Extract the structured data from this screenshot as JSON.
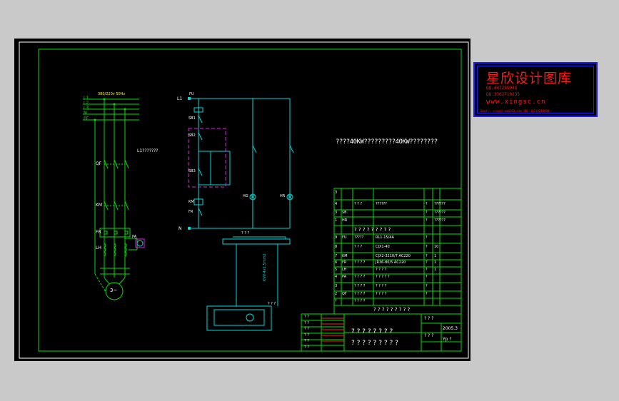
{
  "power_circuit": {
    "supply_label": "380/220v 50Hz",
    "lines": [
      "L1",
      "L2",
      "L3",
      "N",
      "PE"
    ],
    "breaker_note": "L1???????",
    "components": {
      "breaker": "QF",
      "contactor": "KM",
      "relay": "FR",
      "transformer": "LH",
      "ammeter": "PA",
      "motor": "3~"
    }
  },
  "control_circuit": {
    "terminals": {
      "top": "L1",
      "bottom": "N"
    },
    "fuse": "FU",
    "stop_button": "SB1",
    "start_button": "SB2",
    "local_remote": "SB3",
    "relay_contact": "FR",
    "coil": "KM",
    "lamp_green": "HG",
    "lamp_red": "HR",
    "terminal_strip_label": "? ? ?",
    "cable_label": "KVV-4x1.5mm2",
    "station_label": "? ? ?"
  },
  "drawing_title": "????40KW?????????40KW????????",
  "parts_table": {
    "header_cols": [
      "",
      "",
      "",
      "",
      "",
      ""
    ],
    "rows": [
      [
        "3",
        "",
        "",
        "",
        "",
        ""
      ],
      [
        "4",
        "",
        "? ? ?",
        "??????",
        "?",
        "??????"
      ],
      [
        "3",
        "SB",
        "",
        "",
        "?",
        "??????"
      ],
      [
        "1",
        "HR",
        "",
        "",
        "?",
        "??????"
      ],
      [
        "",
        "",
        "? ? ? ? ? ? ? ? ?",
        "",
        "",
        ""
      ],
      [
        "9",
        "FU",
        "?????",
        "RL1-15/4A",
        "?",
        ""
      ],
      [
        "8",
        "",
        "? ? ?",
        "CJX1-40",
        "?",
        "10"
      ],
      [
        "7",
        "KM",
        "",
        "CJX2-3210/7 AC220",
        "?",
        "1"
      ],
      [
        "6",
        "FR",
        "? ? ? ?",
        "JR36-80/5 AC220",
        "?",
        "1"
      ],
      [
        "5",
        "LH",
        "",
        "? ? ? ?",
        "?",
        "1"
      ],
      [
        "4",
        "PA",
        "? ? ? ?",
        "? ? ? ? ?",
        "?",
        ""
      ],
      [
        "3",
        "",
        "? ? ? ?",
        "? ? ? ?",
        "?",
        ""
      ],
      [
        "2",
        "QF",
        "? ? ? ?",
        "? ? ? ?",
        "?",
        ""
      ],
      [
        "?",
        "",
        "? ? ? ?",
        "",
        "",
        ""
      ]
    ],
    "footer": "? ? ? ? ? ? ? ? ?"
  },
  "title_block": {
    "left_rows": [
      "? ?",
      "? ?",
      "? ?",
      "? ?",
      "? ?",
      "? ?"
    ],
    "name1": "? ? ? ? ? ? ? ?",
    "name2": "? ? ? ? ? ? ? ? ?",
    "right_cells": [
      "? ? ?",
      "2005.3",
      "? ? ?",
      "Yp ?"
    ]
  },
  "stamp": {
    "title": "星欣设计图库",
    "qq1": "QQ:447255935",
    "qq2": "QQ:3362719235",
    "url": "www.xingsc.cn",
    "email": "Email: xingsccom@163.com  TEL:15110248800"
  },
  "colors": {
    "green": "#00e000",
    "cyan": "#00d8d8",
    "magenta": "#e020e0",
    "red": "#ff2020",
    "white": "#ffffff",
    "yellow": "#ffff00",
    "blue": "#1d1df0"
  }
}
